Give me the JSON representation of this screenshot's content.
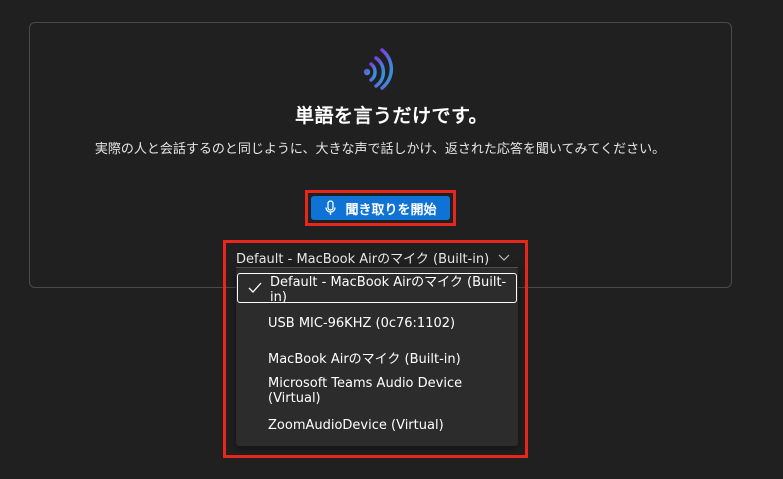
{
  "card": {
    "heading": "単語を言うだけです。",
    "description": "実際の人と会話するのと同じように、大きな声で話しかけ、返された応答を聞いてみてください。",
    "start_button": {
      "label": "聞き取りを開始",
      "icon": "microphone-icon"
    }
  },
  "microphone_select": {
    "selected_value": "Default - MacBook Airのマイク (Built-in)",
    "options": [
      {
        "label": "Default - MacBook Airのマイク (Built-in)",
        "selected": true
      },
      {
        "label": "USB MIC-96KHZ (0c76:1102)",
        "selected": false
      },
      {
        "label": "MacBook Airのマイク (Built-in)",
        "selected": false
      },
      {
        "label": "Microsoft Teams Audio Device (Virtual)",
        "selected": false
      },
      {
        "label": "ZoomAudioDevice (Virtual)",
        "selected": false
      }
    ]
  },
  "colors": {
    "background": "#202020",
    "accent_button": "#0f73d6",
    "highlight": "#e8261b",
    "dropdown_bg": "#2c2c2c",
    "icon_gradient_start": "#6a3fd6",
    "icon_gradient_end": "#2a9bd8"
  }
}
